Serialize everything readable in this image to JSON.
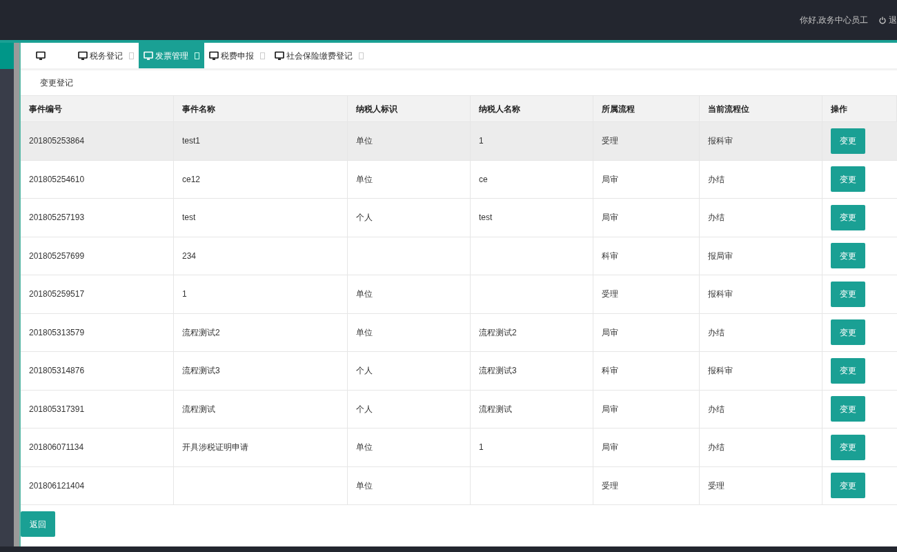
{
  "header": {
    "greeting": "你好,政务中心员工",
    "logout": "退"
  },
  "tabs": [
    {
      "selected": false,
      "closable": false
    },
    {
      "label": "税务登记",
      "selected": false,
      "closable": true
    },
    {
      "label": "发票管理",
      "selected": true,
      "closable": true
    },
    {
      "label": "税费申报",
      "selected": false,
      "closable": true
    },
    {
      "label": "社会保险缴费登记",
      "selected": false,
      "closable": true
    }
  ],
  "subtitle": "变更登记",
  "table": {
    "columns": [
      "事件编号",
      "事件名称",
      "纳税人标识",
      "纳税人名称",
      "所属流程",
      "当前流程位",
      "操作"
    ],
    "rows": [
      {
        "cells": [
          "201805253864",
          "test1",
          "单位",
          "1",
          "受理",
          "报科审"
        ],
        "action": "变更",
        "highlighted": true
      },
      {
        "cells": [
          "201805254610",
          "ce12",
          "单位",
          "ce",
          "局审",
          "办结"
        ],
        "action": "变更",
        "highlighted": false
      },
      {
        "cells": [
          "201805257193",
          "test",
          "个人",
          "test",
          "局审",
          "办结"
        ],
        "action": "变更",
        "highlighted": false
      },
      {
        "cells": [
          "201805257699",
          "234",
          "",
          "",
          "科审",
          "报局审"
        ],
        "action": "变更",
        "highlighted": false
      },
      {
        "cells": [
          "201805259517",
          "1",
          "单位",
          "",
          "受理",
          "报科审"
        ],
        "action": "变更",
        "highlighted": false
      },
      {
        "cells": [
          "201805313579",
          "流程测试2",
          "单位",
          "流程测试2",
          "局审",
          "办结"
        ],
        "action": "变更",
        "highlighted": false
      },
      {
        "cells": [
          "201805314876",
          "流程测试3",
          "个人",
          "流程测试3",
          "科审",
          "报科审"
        ],
        "action": "变更",
        "highlighted": false
      },
      {
        "cells": [
          "201805317391",
          "流程测试",
          "个人",
          "流程测试",
          "局审",
          "办结"
        ],
        "action": "变更",
        "highlighted": false
      },
      {
        "cells": [
          "201806071134",
          "开具涉税证明申请",
          "单位",
          "1",
          "局审",
          "办结"
        ],
        "action": "变更",
        "highlighted": false
      },
      {
        "cells": [
          "201806121404",
          "",
          "单位",
          "",
          "受理",
          "受理"
        ],
        "action": "变更",
        "highlighted": false
      }
    ]
  },
  "back_button": "返回"
}
